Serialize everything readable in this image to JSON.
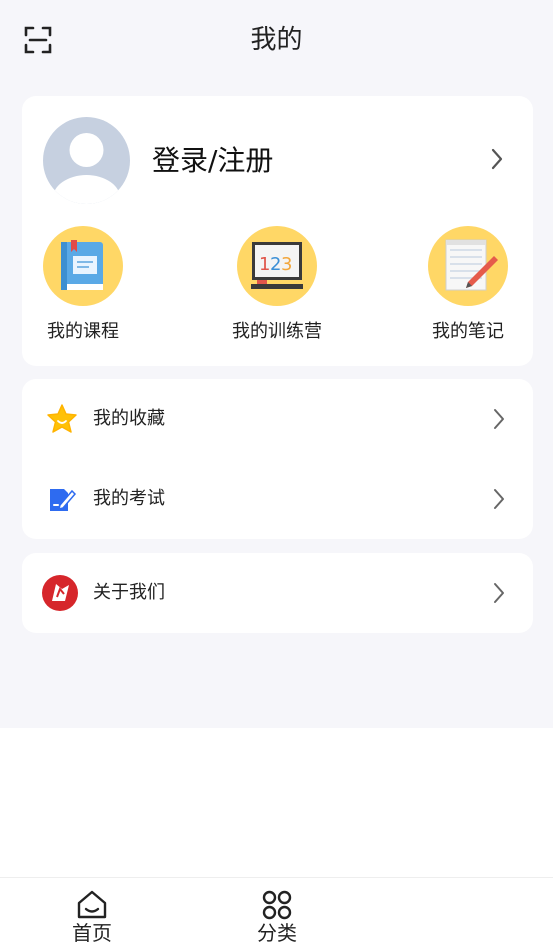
{
  "header": {
    "title": "我的",
    "scan_icon": "scan-icon"
  },
  "profile": {
    "login_label": "登录/注册",
    "avatar_icon": "default-avatar-icon"
  },
  "shortcuts": [
    {
      "label": "我的课程",
      "icon": "book-icon"
    },
    {
      "label": "我的训练营",
      "icon": "blackboard-123-icon"
    },
    {
      "label": "我的笔记",
      "icon": "notepad-pencil-icon"
    }
  ],
  "menu": [
    {
      "label": "我的收藏",
      "icon": "star-icon"
    },
    {
      "label": "我的考试",
      "icon": "exam-edit-icon"
    }
  ],
  "about": {
    "label": "关于我们",
    "icon": "brand-logo-icon"
  },
  "tabbar": [
    {
      "label": "首页",
      "icon": "home-icon"
    },
    {
      "label": "分类",
      "icon": "category-grid-icon"
    }
  ],
  "colors": {
    "page_bg": "#f6f6fa",
    "card_bg": "#ffffff",
    "shortcut_circle": "#ffd766",
    "avatar_bg": "#c6d0e0",
    "star": "#ffc107",
    "exam_blue": "#2e6bf0",
    "logo_red": "#d6262b"
  }
}
